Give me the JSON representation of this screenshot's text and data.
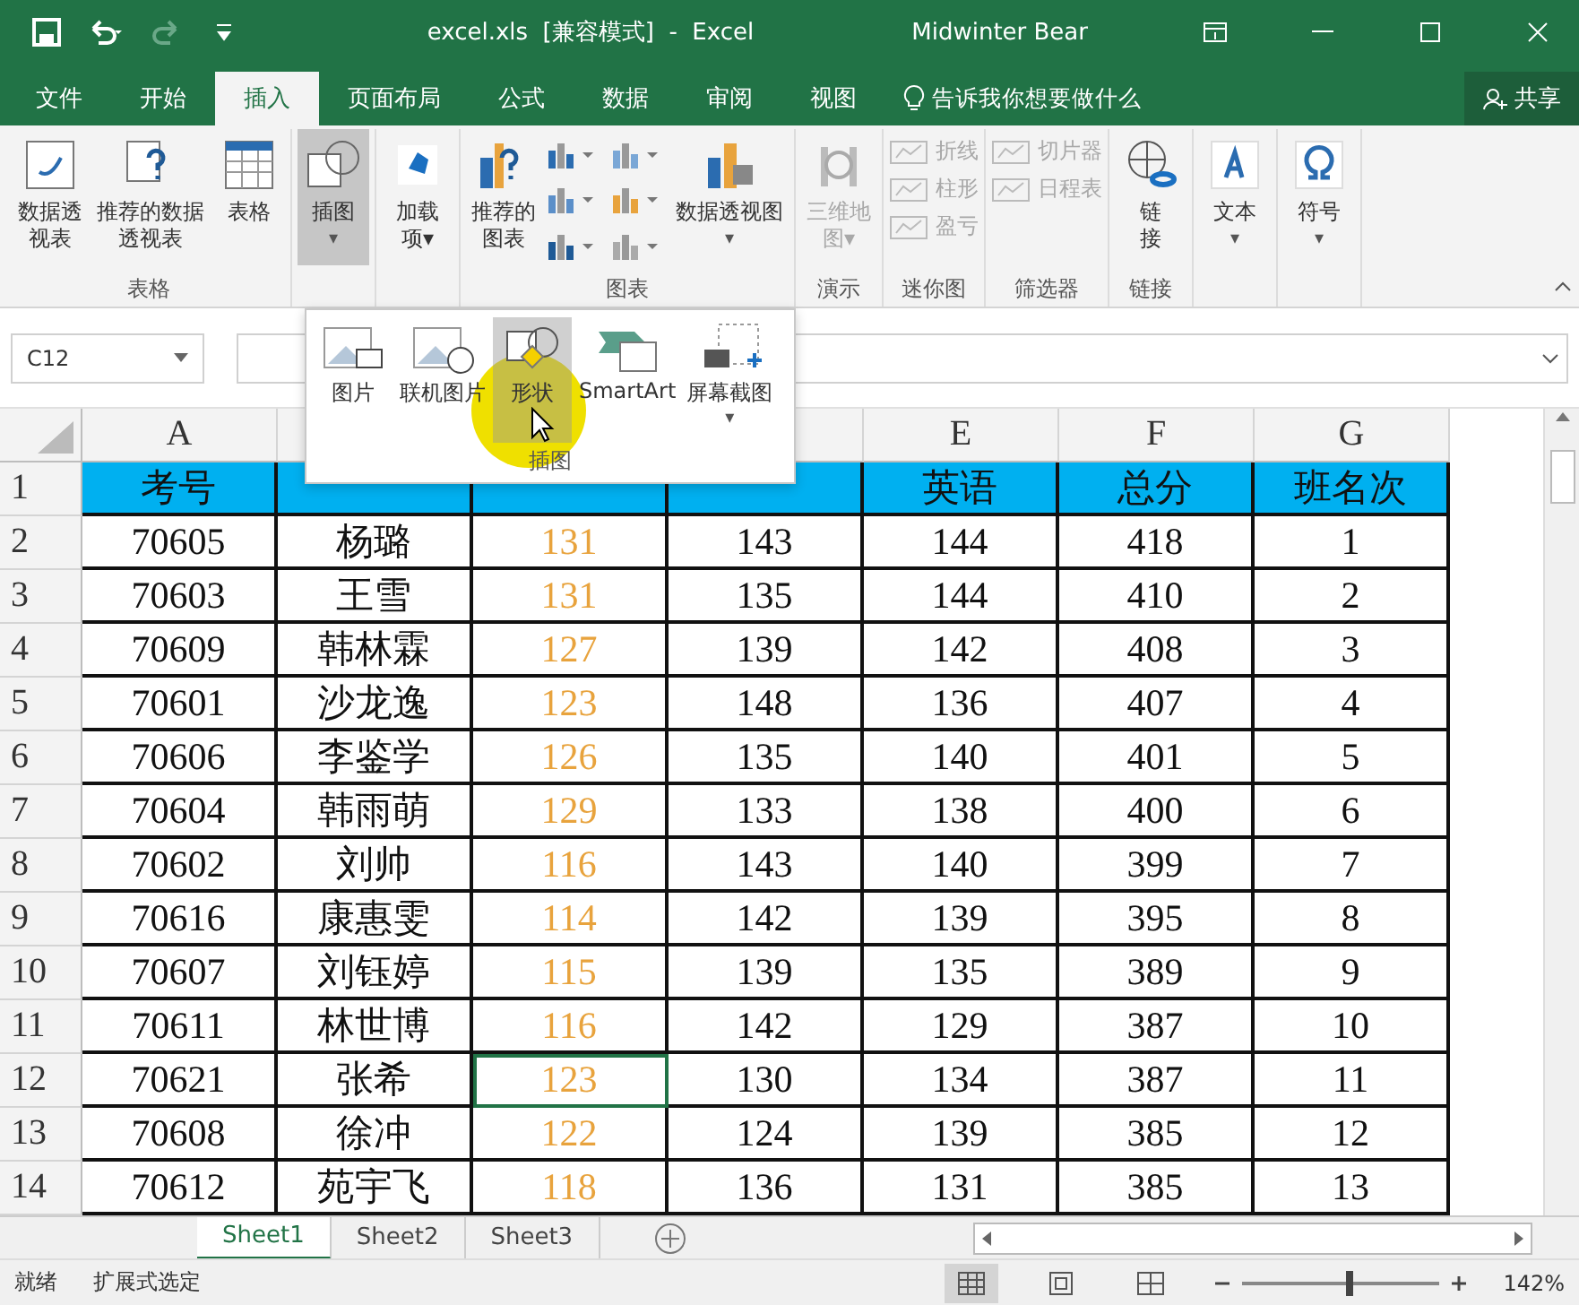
{
  "title_bar": {
    "title": "excel.xls  [兼容模式]  -  Excel",
    "user": "Midwinter Bear"
  },
  "tabs": [
    {
      "label": "文件",
      "selected": false
    },
    {
      "label": "开始",
      "selected": false
    },
    {
      "label": "插入",
      "selected": true
    },
    {
      "label": "页面布局",
      "selected": false
    },
    {
      "label": "公式",
      "selected": false
    },
    {
      "label": "数据",
      "selected": false
    },
    {
      "label": "审阅",
      "selected": false
    },
    {
      "label": "视图",
      "selected": false
    }
  ],
  "tell_me": "告诉我你想要做什么",
  "share": "共享",
  "ribbon": [
    {
      "label": "表格",
      "items": [
        {
          "kind": "large",
          "label": "数据透视表",
          "disabled": false,
          "selected": false
        },
        {
          "kind": "large",
          "label": "推荐的数据透视表",
          "disabled": false,
          "selected": false
        },
        {
          "kind": "large",
          "label": "表格",
          "disabled": false,
          "selected": false
        }
      ]
    },
    {
      "items": [
        {
          "kind": "large",
          "label": "插图",
          "caret": "▾",
          "disabled": false,
          "selected": true
        }
      ]
    },
    {
      "items": [
        {
          "kind": "large",
          "label": "加载项▾",
          "disabled": false,
          "selected": false
        }
      ]
    },
    {
      "label": "图表",
      "items": [
        {
          "kind": "large",
          "label": "推荐的图表",
          "disabled": false,
          "selected": false
        },
        {
          "kind": "chart-grid"
        },
        {
          "kind": "large",
          "label": "数据透视图",
          "caret": "▾",
          "disabled": false,
          "selected": false
        }
      ]
    },
    {
      "label": "演示",
      "items": [
        {
          "kind": "large",
          "label": "三维地图▾",
          "disabled": true,
          "selected": false
        }
      ]
    },
    {
      "label": "迷你图",
      "items": [
        {
          "kind": "stack",
          "entries": [
            "折线",
            "柱形",
            "盈亏"
          ],
          "disabled": true
        }
      ]
    },
    {
      "label": "筛选器",
      "items": [
        {
          "kind": "stack",
          "entries": [
            "切片器",
            "日程表"
          ],
          "disabled": true
        }
      ]
    },
    {
      "label": "链接",
      "items": [
        {
          "kind": "large",
          "label": "链接",
          "disabled": false,
          "selected": false
        }
      ]
    },
    {
      "items": [
        {
          "kind": "large",
          "label": "文本",
          "caret": "▾",
          "disabled": false,
          "selected": false
        }
      ]
    },
    {
      "items": [
        {
          "kind": "large",
          "label": "符号",
          "caret": "▾",
          "disabled": false,
          "selected": false
        }
      ]
    }
  ],
  "name_box": "C12",
  "popup": {
    "label": "插图",
    "items": [
      {
        "label": "图片",
        "selected": false
      },
      {
        "label": "联机图片",
        "selected": false
      },
      {
        "label": "形状",
        "selected": true
      },
      {
        "label": "SmartArt",
        "selected": false
      },
      {
        "label": "屏幕截图",
        "caret": "▾",
        "selected": false
      }
    ]
  },
  "columns": [
    "A",
    "E",
    "F",
    "G"
  ],
  "header_row": [
    "考号",
    "英语",
    "总分",
    "班名次"
  ],
  "header_row_number": "1",
  "rows": [
    {
      "n": "2",
      "cells": [
        {
          "t": "70605",
          "selected": false
        },
        {
          "t": "杨璐",
          "selected": false
        },
        {
          "t": "131",
          "selected": false
        },
        {
          "t": "143",
          "selected": false
        },
        {
          "t": "144",
          "selected": false
        },
        {
          "t": "418",
          "selected": false
        },
        {
          "t": "1",
          "selected": false
        }
      ]
    },
    {
      "n": "3",
      "cells": [
        {
          "t": "70603",
          "selected": false
        },
        {
          "t": "王雪",
          "selected": false
        },
        {
          "t": "131",
          "selected": false
        },
        {
          "t": "135",
          "selected": false
        },
        {
          "t": "144",
          "selected": false
        },
        {
          "t": "410",
          "selected": false
        },
        {
          "t": "2",
          "selected": false
        }
      ]
    },
    {
      "n": "4",
      "cells": [
        {
          "t": "70609",
          "selected": false
        },
        {
          "t": "韩林霖",
          "selected": false
        },
        {
          "t": "127",
          "selected": false
        },
        {
          "t": "139",
          "selected": false
        },
        {
          "t": "142",
          "selected": false
        },
        {
          "t": "408",
          "selected": false
        },
        {
          "t": "3",
          "selected": false
        }
      ]
    },
    {
      "n": "5",
      "cells": [
        {
          "t": "70601",
          "selected": false
        },
        {
          "t": "沙龙逸",
          "selected": false
        },
        {
          "t": "123",
          "selected": false
        },
        {
          "t": "148",
          "selected": false
        },
        {
          "t": "136",
          "selected": false
        },
        {
          "t": "407",
          "selected": false
        },
        {
          "t": "4",
          "selected": false
        }
      ]
    },
    {
      "n": "6",
      "cells": [
        {
          "t": "70606",
          "selected": false
        },
        {
          "t": "李鉴学",
          "selected": false
        },
        {
          "t": "126",
          "selected": false
        },
        {
          "t": "135",
          "selected": false
        },
        {
          "t": "140",
          "selected": false
        },
        {
          "t": "401",
          "selected": false
        },
        {
          "t": "5",
          "selected": false
        }
      ]
    },
    {
      "n": "7",
      "cells": [
        {
          "t": "70604",
          "selected": false
        },
        {
          "t": "韩雨萌",
          "selected": false
        },
        {
          "t": "129",
          "selected": false
        },
        {
          "t": "133",
          "selected": false
        },
        {
          "t": "138",
          "selected": false
        },
        {
          "t": "400",
          "selected": false
        },
        {
          "t": "6",
          "selected": false
        }
      ]
    },
    {
      "n": "8",
      "cells": [
        {
          "t": "70602",
          "selected": false
        },
        {
          "t": "刘帅",
          "selected": false
        },
        {
          "t": "116",
          "selected": false
        },
        {
          "t": "143",
          "selected": false
        },
        {
          "t": "140",
          "selected": false
        },
        {
          "t": "399",
          "selected": false
        },
        {
          "t": "7",
          "selected": false
        }
      ]
    },
    {
      "n": "9",
      "cells": [
        {
          "t": "70616",
          "selected": false
        },
        {
          "t": "康惠雯",
          "selected": false
        },
        {
          "t": "114",
          "selected": false
        },
        {
          "t": "142",
          "selected": false
        },
        {
          "t": "139",
          "selected": false
        },
        {
          "t": "395",
          "selected": false
        },
        {
          "t": "8",
          "selected": false
        }
      ]
    },
    {
      "n": "10",
      "cells": [
        {
          "t": "70607",
          "selected": false
        },
        {
          "t": "刘钰婷",
          "selected": false
        },
        {
          "t": "115",
          "selected": false
        },
        {
          "t": "139",
          "selected": false
        },
        {
          "t": "135",
          "selected": false
        },
        {
          "t": "389",
          "selected": false
        },
        {
          "t": "9",
          "selected": false
        }
      ]
    },
    {
      "n": "11",
      "cells": [
        {
          "t": "70611",
          "selected": false
        },
        {
          "t": "林世博",
          "selected": false
        },
        {
          "t": "116",
          "selected": false
        },
        {
          "t": "142",
          "selected": false
        },
        {
          "t": "129",
          "selected": false
        },
        {
          "t": "387",
          "selected": false
        },
        {
          "t": "10",
          "selected": false
        }
      ]
    },
    {
      "n": "12",
      "cells": [
        {
          "t": "70621",
          "selected": false
        },
        {
          "t": "张希",
          "selected": false
        },
        {
          "t": "123",
          "selected": true
        },
        {
          "t": "130",
          "selected": false
        },
        {
          "t": "134",
          "selected": false
        },
        {
          "t": "387",
          "selected": false
        },
        {
          "t": "11",
          "selected": false
        }
      ]
    },
    {
      "n": "13",
      "cells": [
        {
          "t": "70608",
          "selected": false
        },
        {
          "t": "徐冲",
          "selected": false
        },
        {
          "t": "122",
          "selected": false
        },
        {
          "t": "124",
          "selected": false
        },
        {
          "t": "139",
          "selected": false
        },
        {
          "t": "385",
          "selected": false
        },
        {
          "t": "12",
          "selected": false
        }
      ]
    },
    {
      "n": "14",
      "cells": [
        {
          "t": "70612",
          "selected": false
        },
        {
          "t": "苑宇飞",
          "selected": false
        },
        {
          "t": "118",
          "selected": false
        },
        {
          "t": "136",
          "selected": false
        },
        {
          "t": "131",
          "selected": false
        },
        {
          "t": "385",
          "selected": false
        },
        {
          "t": "13",
          "selected": false
        }
      ]
    }
  ],
  "sheets": [
    {
      "label": "Sheet1",
      "selected": true
    },
    {
      "label": "Sheet2",
      "selected": false
    },
    {
      "label": "Sheet3",
      "selected": false
    }
  ],
  "status": {
    "ready": "就绪",
    "mode": "扩展式选定",
    "zoom": "142%",
    "zoom_slider": {
      "level": 0.55
    }
  }
}
